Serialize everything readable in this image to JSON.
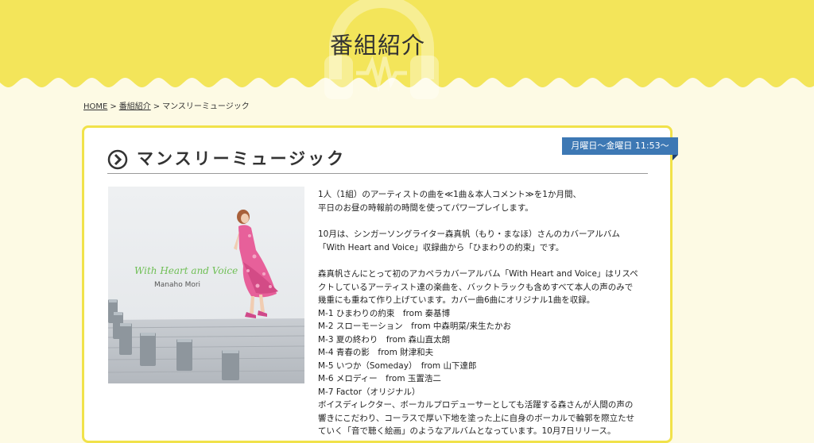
{
  "header": {
    "title": "番組紹介"
  },
  "breadcrumb": {
    "home": "HOME",
    "separator": ">",
    "parent": "番組紹介",
    "current": "マンスリーミュージック"
  },
  "program": {
    "schedule": "月曜日〜金曜日 11:53〜",
    "title": "マンスリーミュージック",
    "album": {
      "title": "With Heart and Voice",
      "artist": "Manaho Mori"
    },
    "intro": [
      "1人（1組）のアーティストの曲を≪1曲＆本人コメント≫を1か月間、",
      "平日のお昼の時報前の時間を使ってパワープレイします。"
    ],
    "feature": [
      "10月は、シンガーソングライター森真帆（もり・まなほ）さんのカバーアルバム",
      "「With Heart and Voice」収録曲から「ひまわりの約束」です。"
    ],
    "details": [
      "森真帆さんにとって初のアカペラカバーアルバム「With Heart and Voice」はリスペ",
      "クトしているアーティスト達の楽曲を、バックトラックも含めすべて本人の声のみで",
      "幾重にも重ねて作り上げています。カバー曲6曲にオリジナル1曲を収録。",
      "M-1 ひまわりの約束　from 秦基博",
      "M-2 スローモーション　from 中森明菜/来生たかお",
      "M-3 夏の終わり　from 森山直太朗",
      "M-4 青春の影　from 財津和夫",
      "M-5 いつか（Someday）　from 山下達郎",
      "M-6 メロディー　from 玉置浩二",
      "M-7 Factor（オリジナル）",
      "ボイスディレクター、ボーカルプロデューサーとしても活躍する森さんが人間の声の",
      "響きにこだわり、コーラスで厚い下地を塗った上に自身のボーカルで輪郭を際立たせ",
      "ていく「音で聴く絵画」のようなアルバムとなっています。10月7日リリース。"
    ]
  },
  "colors": {
    "header_yellow": "#f3e55a",
    "page_bg": "#fdfae4",
    "card_border": "#f1e24a",
    "ribbon_blue": "#3d78b4",
    "album_script_green": "#6fbf55"
  },
  "icons": {
    "section": "chevron-circle-icon",
    "header_decoration": "headphones-icon"
  }
}
